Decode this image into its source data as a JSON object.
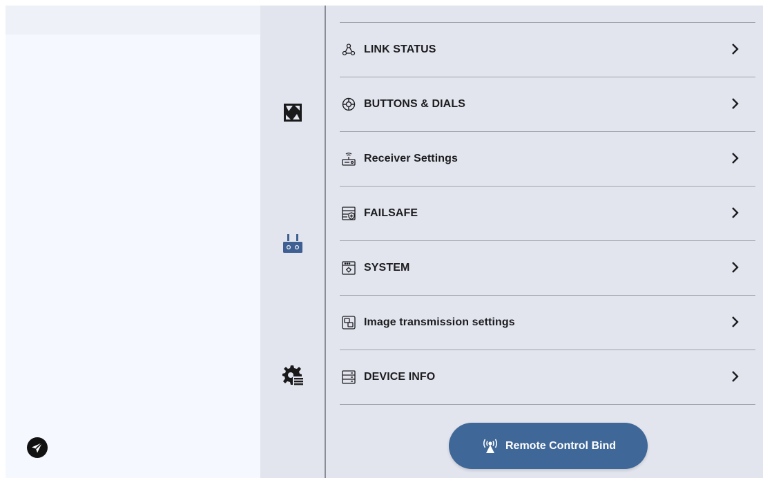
{
  "colors": {
    "accent": "#3f6797",
    "rail_active_icon": "#3d5f91",
    "panel_bg": "#e2e5ee",
    "left_bg": "#f5f8fe",
    "text": "#1c1c1f"
  },
  "left_panel": {
    "fab_icon": "send-icon"
  },
  "rail": {
    "items": [
      {
        "icon": "camera-settings-icon",
        "active": false
      },
      {
        "icon": "remote-controller-icon",
        "active": true
      },
      {
        "icon": "gear-list-icon",
        "active": false
      }
    ]
  },
  "menu": {
    "items": [
      {
        "label": "LINK STATUS",
        "icon": "link-status-icon"
      },
      {
        "label": "BUTTONS & DIALS",
        "icon": "dial-icon"
      },
      {
        "label": "Receiver Settings",
        "icon": "receiver-icon"
      },
      {
        "label": "FAILSAFE",
        "icon": "failsafe-icon"
      },
      {
        "label": "SYSTEM",
        "icon": "system-icon"
      },
      {
        "label": "Image transmission settings",
        "icon": "image-transmission-icon"
      },
      {
        "label": "DEVICE INFO",
        "icon": "device-info-icon"
      }
    ]
  },
  "bind_button": {
    "label": "Remote Control Bind",
    "icon": "antenna-signal-icon"
  }
}
